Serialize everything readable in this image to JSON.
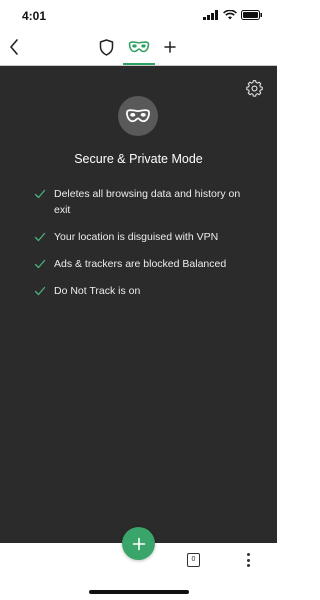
{
  "status_bar": {
    "time": "4:01",
    "icons": [
      "signal-icon",
      "wifi-icon",
      "battery-icon"
    ]
  },
  "toolbar": {
    "icons": [
      "chevron-left-icon",
      "shield-icon",
      "mask-icon",
      "plus-icon"
    ],
    "active_tab_color": "#2f9f63"
  },
  "private_mode": {
    "title": "Secure & Private Mode",
    "features": [
      {
        "text": "Deletes all browsing data and history on exit"
      },
      {
        "text": "Your location is disguised with VPN"
      },
      {
        "text": "Ads & trackers are blocked Balanced"
      },
      {
        "text": "Do Not Track is on"
      }
    ],
    "background_color": "#2b2b2b",
    "check_color": "#4caf7a",
    "icons": [
      "gear-icon",
      "mask-icon",
      "check-icon"
    ]
  },
  "bottom_bar": {
    "tab_count": "0",
    "fab_color": "#3aa56a",
    "icons": [
      "plus-icon",
      "tab-counter-icon",
      "more-vertical-icon"
    ]
  }
}
